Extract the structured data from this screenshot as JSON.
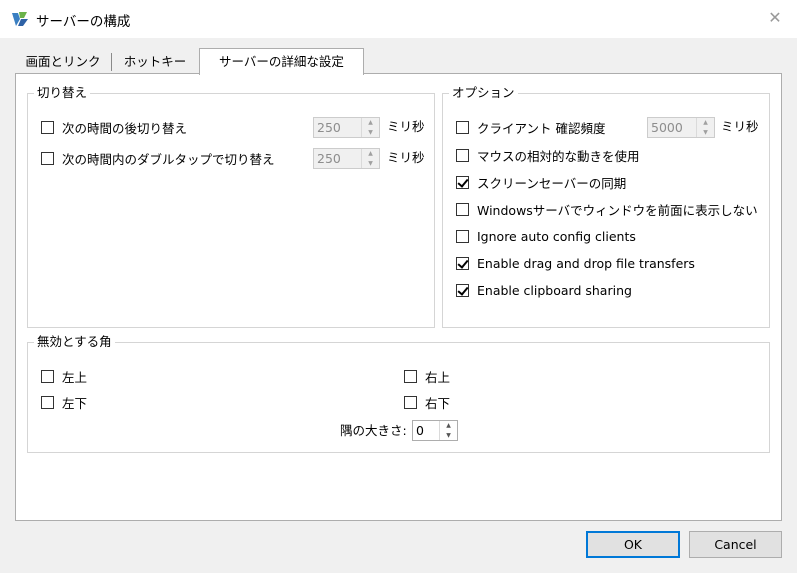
{
  "window": {
    "title": "サーバーの構成",
    "close_glyph": "✕"
  },
  "tabs": [
    {
      "label": "画面とリンク",
      "selected": false
    },
    {
      "label": "ホットキー",
      "selected": false
    },
    {
      "label": "サーバーの詳細な設定",
      "selected": true
    }
  ],
  "switching": {
    "legend": "切り替え",
    "items": [
      {
        "label": "次の時間の後切り替え",
        "checked": false,
        "value": "250",
        "unit": "ミリ秒"
      },
      {
        "label": "次の時間内のダブルタップで切り替え",
        "checked": false,
        "value": "250",
        "unit": "ミリ秒"
      }
    ]
  },
  "options": {
    "legend": "オプション",
    "heartbeat": {
      "label": "クライアント 確認頻度",
      "checked": false,
      "value": "5000",
      "unit": "ミリ秒"
    },
    "items": [
      {
        "label": "マウスの相対的な動きを使用",
        "checked": false
      },
      {
        "label": "スクリーンセーバーの同期",
        "checked": true
      },
      {
        "label": "Windowsサーバでウィンドウを前面に表示しない",
        "checked": false
      },
      {
        "label": "Ignore auto config clients",
        "checked": false
      },
      {
        "label": "Enable drag and drop file transfers",
        "checked": true
      },
      {
        "label": "Enable clipboard sharing",
        "checked": true
      }
    ]
  },
  "dead_corners": {
    "legend": "無効とする角",
    "top_left": "左上",
    "top_right": "右上",
    "bottom_left": "左下",
    "bottom_right": "右下",
    "corner_size_label": "隅の大きさ:",
    "corner_size_value": "0"
  },
  "buttons": {
    "ok": "OK",
    "cancel": "Cancel"
  },
  "colors": {
    "accent": "#0078d7",
    "panel_bg": "#ffffff",
    "window_bg": "#f0f0f0"
  }
}
